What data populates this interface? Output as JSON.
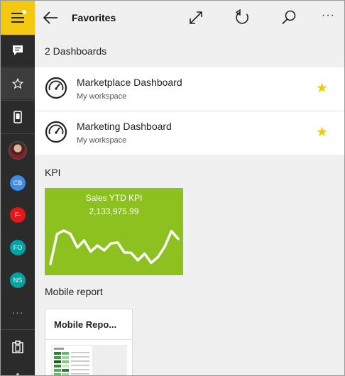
{
  "header": {
    "title": "Favorites",
    "more_label": "···"
  },
  "sidebar": {
    "items": [
      {
        "icon": "hamburger-menu-icon"
      },
      {
        "icon": "chat-icon"
      },
      {
        "icon": "star-icon"
      },
      {
        "icon": "phone-icon"
      },
      {
        "icon": "user-photo"
      },
      {
        "initials": "CB",
        "color": "#3b8ee8"
      },
      {
        "initials": "F-",
        "color": "#e31818"
      },
      {
        "initials": "FO",
        "color": "#00a3a3"
      },
      {
        "initials": "NS",
        "color": "#00a3a3"
      },
      {
        "more": "···"
      },
      {
        "icon": "clipboard-icon"
      }
    ]
  },
  "dashboards": {
    "heading": "2 Dashboards",
    "items": [
      {
        "name": "Marketplace Dashboard",
        "workspace": "My workspace",
        "favorite": "★"
      },
      {
        "name": "Marketing Dashboard",
        "workspace": "My workspace",
        "favorite": "★"
      }
    ]
  },
  "kpi": {
    "heading": "KPI",
    "tile": {
      "title": "Sales YTD KPI",
      "value": "2,133,975.99",
      "color": "#8cc11f",
      "trend": [
        0.05,
        0.78,
        0.86,
        0.78,
        0.45,
        0.62,
        0.35,
        0.5,
        0.38,
        0.55,
        0.57,
        0.33,
        0.32,
        0.14,
        0.3,
        0.08,
        0.22,
        0.47,
        0.85,
        0.66
      ]
    }
  },
  "mobile": {
    "heading": "Mobile report",
    "card_title": "Mobile Repo..."
  },
  "colors": {
    "accent": "#f2c811",
    "rail": "#2b2b2b",
    "kpi_green": "#8cc11f"
  }
}
